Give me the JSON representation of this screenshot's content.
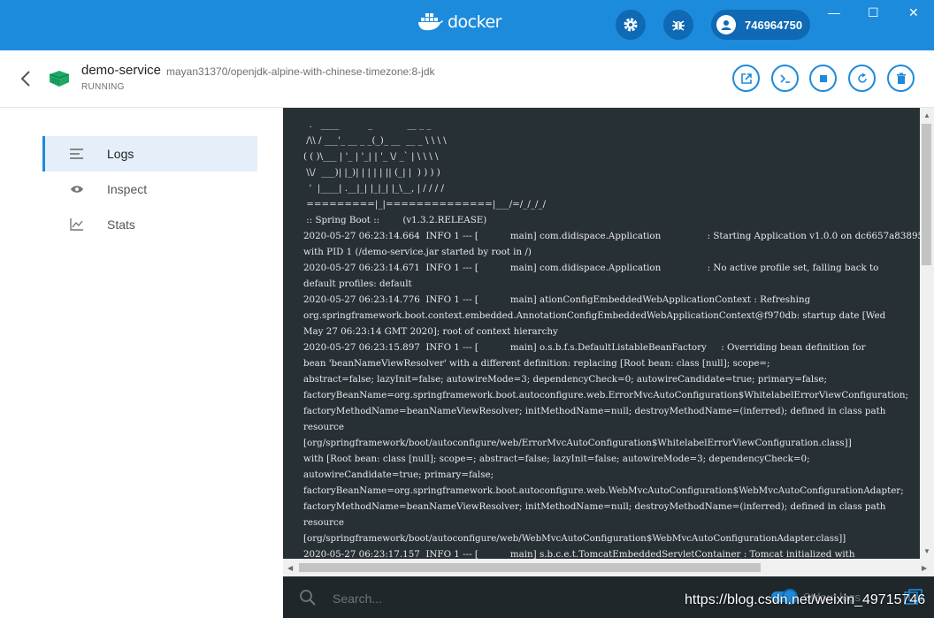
{
  "app": {
    "logo_text": "docker",
    "account_id": "746964750"
  },
  "window_controls": {
    "minimize": "—",
    "maximize": "☐",
    "close": "✕"
  },
  "container": {
    "name": "demo-service",
    "image": "mayan31370/openjdk-alpine-with-chinese-timezone:8-jdk",
    "status": "RUNNING"
  },
  "sidebar": {
    "items": [
      {
        "label": "Logs",
        "icon": "logs-icon",
        "active": true
      },
      {
        "label": "Inspect",
        "icon": "eye-icon",
        "active": false
      },
      {
        "label": "Stats",
        "icon": "stats-icon",
        "active": false
      }
    ]
  },
  "actions": [
    "open-in-browser-icon",
    "cli-icon",
    "stop-icon",
    "restart-icon",
    "delete-icon"
  ],
  "log_lines": [
    "  .   ____          _            __ _ _",
    " /\\\\ / ___'_ __ _ _(_)_ __  __ _ \\ \\ \\ \\",
    "( ( )\\___ | '_ | '_| | '_ \\/ _` | \\ \\ \\ \\",
    " \\\\/  ___)| |_)| | | | | || (_| |  ) ) ) )",
    "  '  |____| .__|_| |_|_| |_\\__, | / / / /",
    " =========|_|==============|___/=/_/_/_/",
    " :: Spring Boot ::        (v1.3.2.RELEASE)",
    "2020-05-27 06:23:14.664  INFO 1 --- [           main] com.didispace.Application                : Starting Application v1.0.0 on dc6657a83895",
    "with PID 1 (/demo-service.jar started by root in /)",
    "2020-05-27 06:23:14.671  INFO 1 --- [           main] com.didispace.Application                : No active profile set, falling back to",
    "default profiles: default",
    "2020-05-27 06:23:14.776  INFO 1 --- [           main] ationConfigEmbeddedWebApplicationContext : Refreshing",
    "org.springframework.boot.context.embedded.AnnotationConfigEmbeddedWebApplicationContext@f970db: startup date [Wed",
    "May 27 06:23:14 GMT 2020]; root of context hierarchy",
    "2020-05-27 06:23:15.897  INFO 1 --- [           main] o.s.b.f.s.DefaultListableBeanFactory     : Overriding bean definition for",
    "bean 'beanNameViewResolver' with a different definition: replacing [Root bean: class [null]; scope=;",
    "abstract=false; lazyInit=false; autowireMode=3; dependencyCheck=0; autowireCandidate=true; primary=false;",
    "factoryBeanName=org.springframework.boot.autoconfigure.web.ErrorMvcAutoConfiguration$WhitelabelErrorViewConfiguration;",
    "factoryMethodName=beanNameViewResolver; initMethodName=null; destroyMethodName=(inferred); defined in class path",
    "resource",
    "[org/springframework/boot/autoconfigure/web/ErrorMvcAutoConfiguration$WhitelabelErrorViewConfiguration.class]]",
    "with [Root bean: class [null]; scope=; abstract=false; lazyInit=false; autowireMode=3; dependencyCheck=0;",
    "autowireCandidate=true; primary=false;",
    "factoryBeanName=org.springframework.boot.autoconfigure.web.WebMvcAutoConfiguration$WebMvcAutoConfigurationAdapter;",
    "factoryMethodName=beanNameViewResolver; initMethodName=null; destroyMethodName=(inferred); defined in class path",
    "resource",
    "[org/springframework/boot/autoconfigure/web/WebMvcAutoConfiguration$WebMvcAutoConfigurationAdapter.class]]",
    "2020-05-27 06:23:17.157  INFO 1 --- [           main] s.b.c.e.t.TomcatEmbeddedServletContainer : Tomcat initialized with"
  ],
  "search": {
    "placeholder": "Search...",
    "value": ""
  },
  "follow_toggle": {
    "label": "Stdout logs",
    "on": true
  },
  "watermark": "https://blog.csdn.net/weixin_49715746",
  "colors": {
    "brand": "#1d8bdc",
    "brand_dark": "#0f69b4",
    "console_bg": "#273035"
  }
}
